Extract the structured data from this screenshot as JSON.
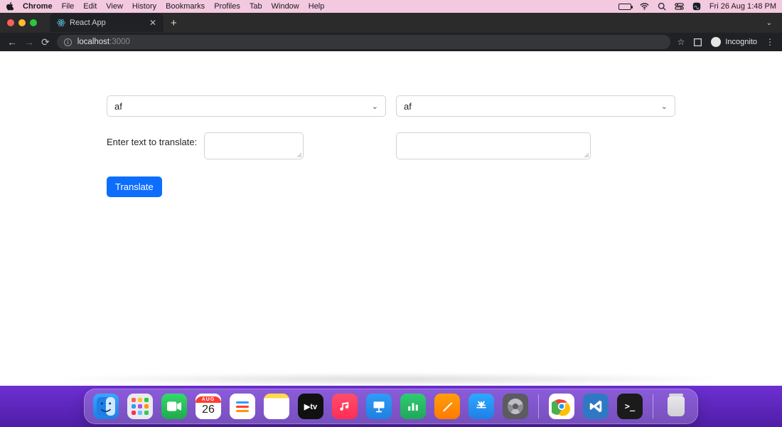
{
  "menubar": {
    "app_name": "Chrome",
    "items": [
      "File",
      "Edit",
      "View",
      "History",
      "Bookmarks",
      "Profiles",
      "Tab",
      "Window",
      "Help"
    ],
    "clock": "Fri 26 Aug  1:48 PM"
  },
  "browser": {
    "tab_title": "React App",
    "url_host": "localhost",
    "url_port": ":3000",
    "profile_label": "Incognito"
  },
  "page": {
    "select_left": "af",
    "select_right": "af",
    "input_label": "Enter text to translate:",
    "translate_button": "Translate"
  },
  "dock": {
    "calendar_month": "AUG",
    "calendar_day": "26",
    "appletv_label": "▶tv",
    "terminal_prompt": ">_"
  }
}
